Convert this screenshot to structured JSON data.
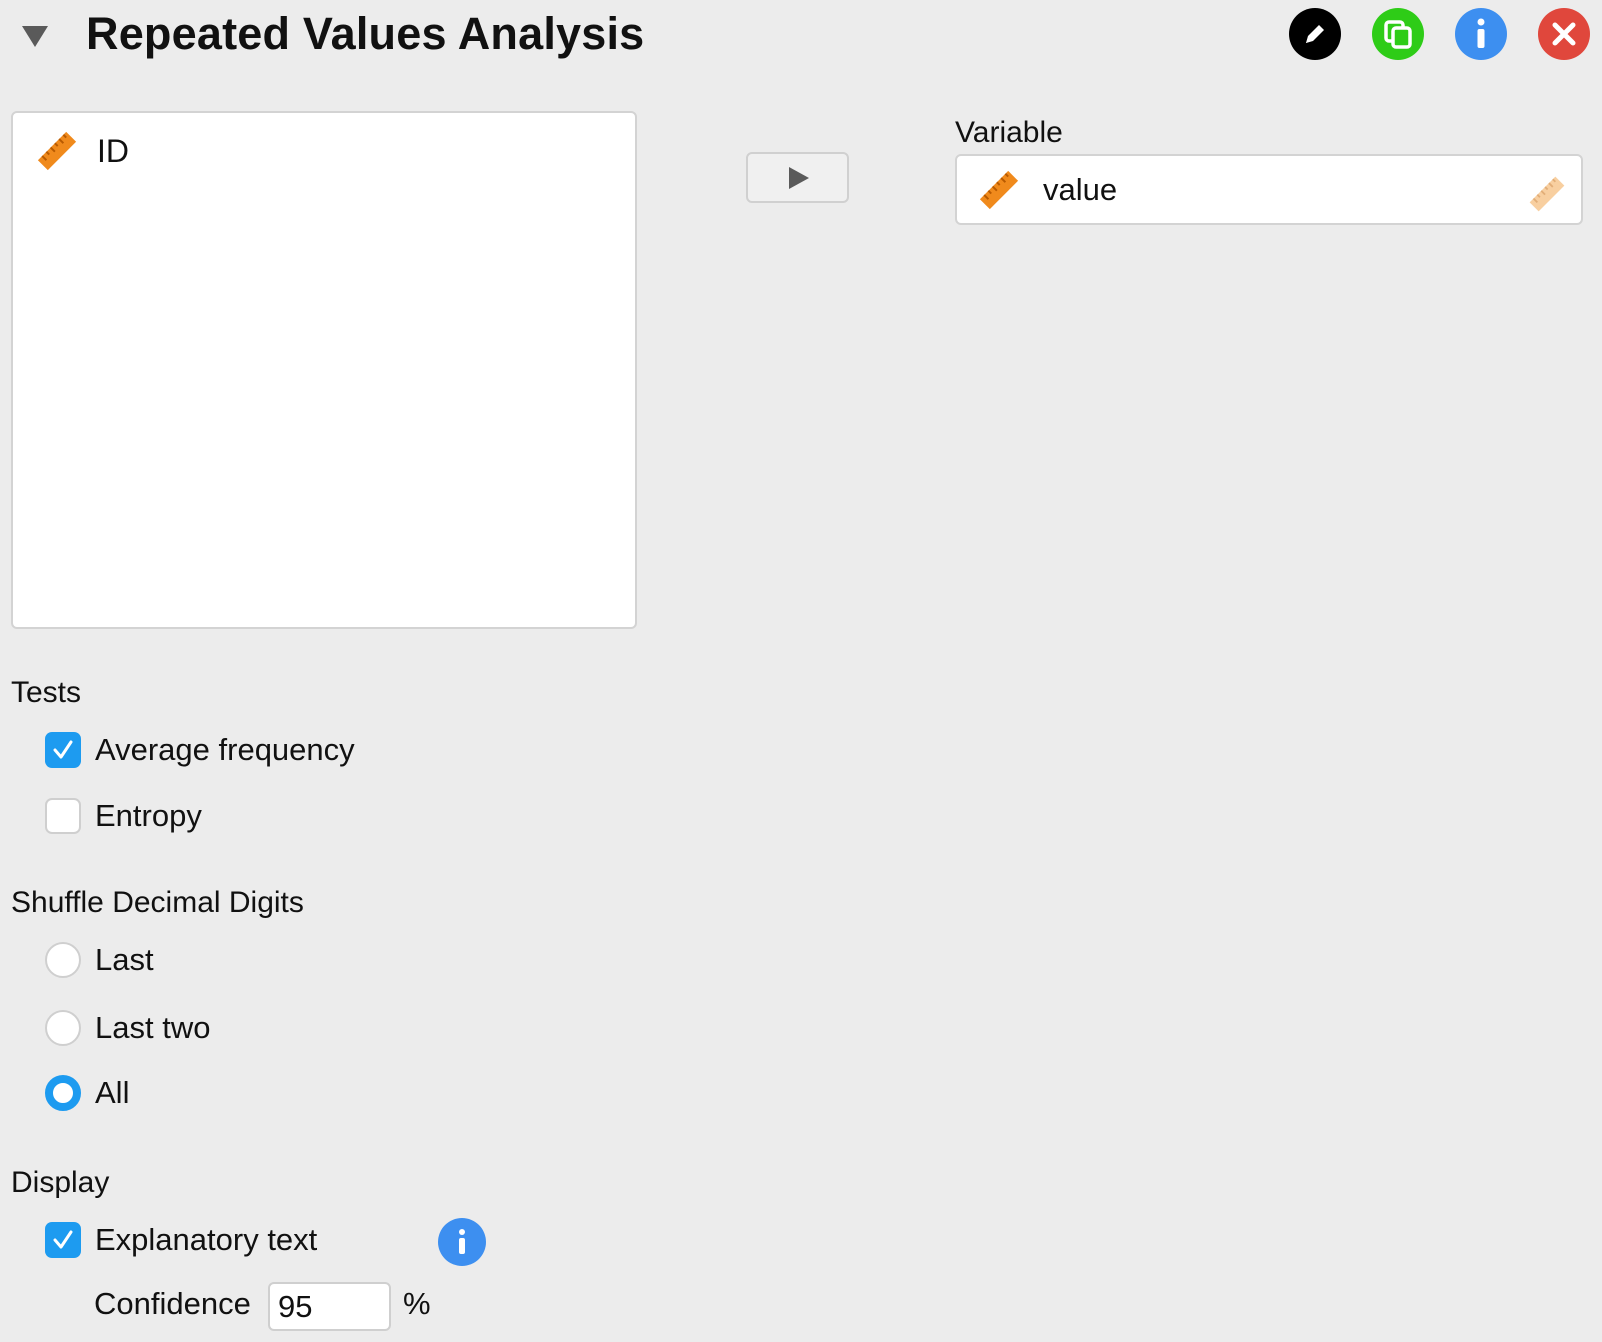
{
  "header": {
    "title": "Repeated Values Analysis",
    "buttons": [
      {
        "icon": "pencil-icon",
        "color": "#000000"
      },
      {
        "icon": "copy-icon",
        "color": "#2ecc17"
      },
      {
        "icon": "info-icon",
        "color": "#3d8ff0"
      },
      {
        "icon": "close-icon",
        "color": "#e0473c"
      }
    ]
  },
  "available_variables": {
    "items": [
      {
        "label": "ID",
        "icon": "scale-ruler-icon"
      }
    ]
  },
  "move_button": {
    "icon": "play-arrow-icon"
  },
  "variable_field": {
    "label": "Variable",
    "items": [
      {
        "label": "value",
        "icon": "scale-ruler-icon",
        "type_icon": "scale-ruler-faded-icon"
      }
    ]
  },
  "tests": {
    "label": "Tests",
    "options": [
      {
        "label": "Average frequency",
        "checked": true
      },
      {
        "label": "Entropy",
        "checked": false
      }
    ]
  },
  "shuffle": {
    "label": "Shuffle Decimal Digits",
    "options": [
      {
        "label": "Last",
        "selected": false
      },
      {
        "label": "Last two",
        "selected": false
      },
      {
        "label": "All",
        "selected": true
      }
    ]
  },
  "display": {
    "label": "Display",
    "explanatory_text": {
      "label": "Explanatory text",
      "checked": true
    },
    "confidence": {
      "label": "Confidence",
      "value": "95",
      "unit": "%"
    }
  },
  "colors": {
    "accent": "#1d9bf0",
    "ruler": "#f08a1c",
    "background": "#ececec"
  }
}
